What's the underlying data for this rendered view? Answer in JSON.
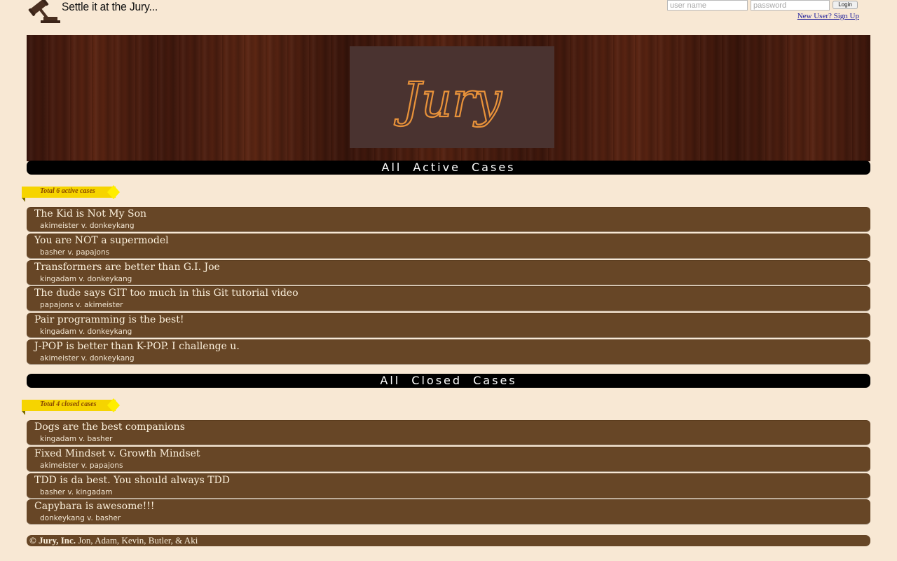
{
  "header": {
    "tagline": "Settle it at the Jury...",
    "username_placeholder": "user name",
    "password_placeholder": "password",
    "login_label": "Login",
    "signup_label": "New User? Sign Up"
  },
  "banner": {
    "logo_text": "Jury"
  },
  "active": {
    "heading": "All Active Cases",
    "count_label": "Total 6 active cases",
    "cases": [
      {
        "title": "The Kid is Not My Son",
        "parties": "akimeister v. donkeykang"
      },
      {
        "title": "You are NOT a supermodel",
        "parties": "basher v. papajons"
      },
      {
        "title": "Transformers are better than G.I. Joe",
        "parties": "kingadam v. donkeykang"
      },
      {
        "title": "The dude says GIT too much in this Git tutorial video",
        "parties": "papajons v. akimeister"
      },
      {
        "title": "Pair programming is the best!",
        "parties": "kingadam v. donkeykang"
      },
      {
        "title": "J-POP is better than K-POP. I challenge u.",
        "parties": "akimeister v. donkeykang"
      }
    ]
  },
  "closed": {
    "heading": "All Closed Cases",
    "count_label": "Total 4 closed cases",
    "cases": [
      {
        "title": "Dogs are the best companions",
        "parties": "kingadam v. basher"
      },
      {
        "title": "Fixed Mindset v. Growth Mindset",
        "parties": "akimeister v. papajons"
      },
      {
        "title": "TDD is da best. You should always TDD",
        "parties": "basher v. kingadam"
      },
      {
        "title": "Capybara is awesome!!!",
        "parties": "donkeykang v. basher"
      }
    ]
  },
  "footer": {
    "company": "© Jury, Inc.",
    "credits": "Jon, Adam, Kevin, Butler, & Aki"
  },
  "colors": {
    "page_bg": "#f8e8d4",
    "card_bg": "#674626",
    "ribbon": "#f6d400",
    "logo_stroke": "#e8923a"
  }
}
